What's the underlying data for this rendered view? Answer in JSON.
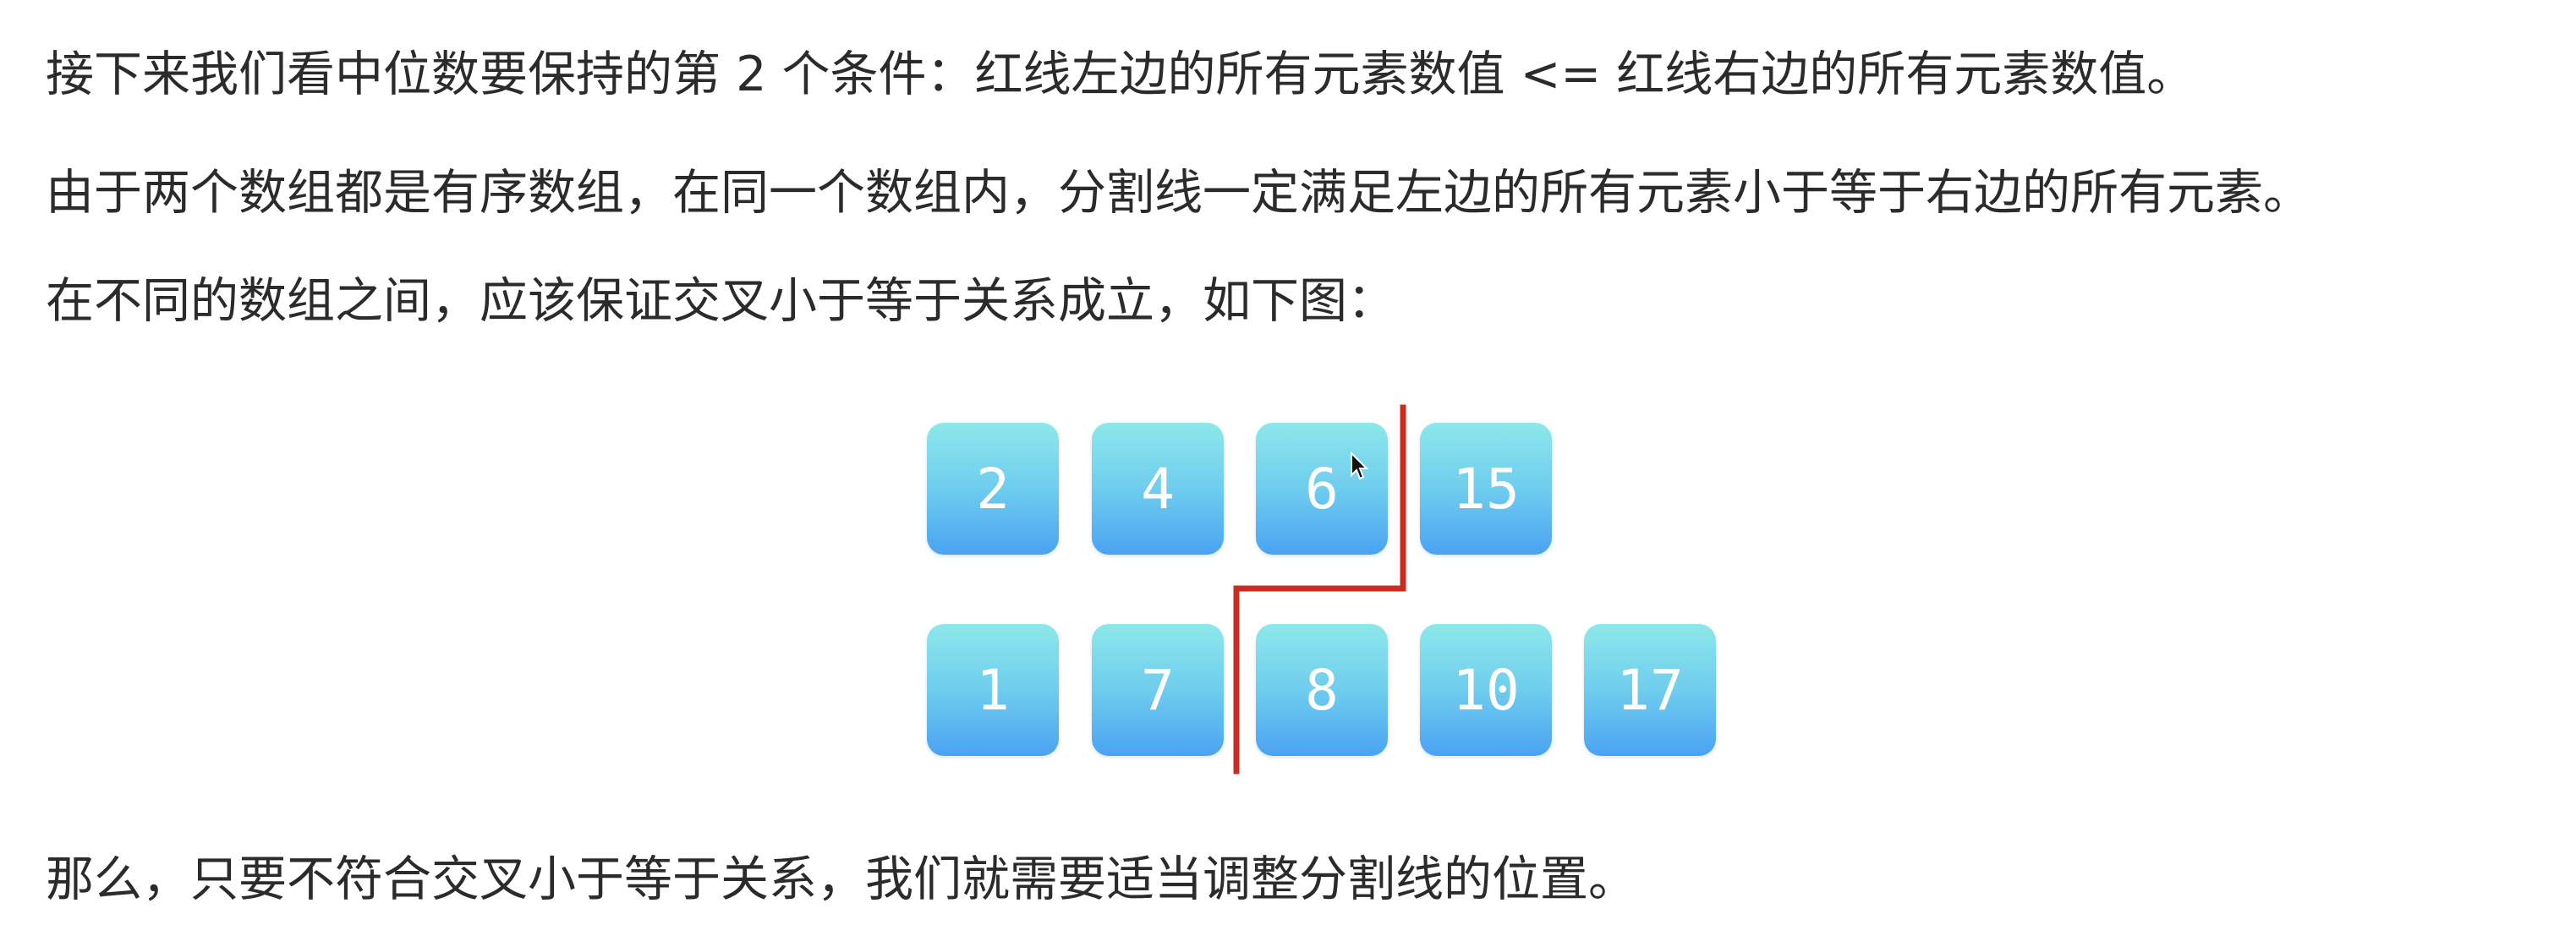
{
  "paragraphs": [
    "接下来我们看中位数要保持的第 2 个条件：红线左边的所有元素数值 <= 红线右边的所有元素数值。",
    "由于两个数组都是有序数组，在同一个数组内，分割线一定满足左边的所有元素小于等于右边的所有元素。",
    "在不同的数组之间，应该保证交叉小于等于关系成立，如下图：",
    "那么，只要不符合交叉小于等于关系，我们就需要适当调整分割线的位置。"
  ],
  "diagram": {
    "array_top": [
      "2",
      "4",
      "6",
      "15"
    ],
    "array_bottom": [
      "1",
      "7",
      "8",
      "10",
      "17"
    ],
    "split_color": "#cc2b1f",
    "tile_gradient_top": "#8de8ea",
    "tile_gradient_bottom": "#4aa3f2"
  }
}
